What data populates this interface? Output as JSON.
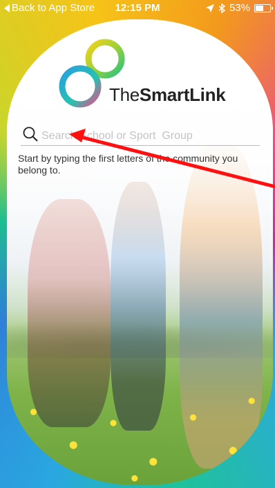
{
  "status_bar": {
    "back_label": "Back to App Store",
    "time": "12:15 PM",
    "battery": "53%"
  },
  "logo": {
    "prefix": "The",
    "bold": "SmartLink"
  },
  "search": {
    "placeholder": "Search School or Sport  Group",
    "value": ""
  },
  "hint": "Start by typing the first letters of the community you belong to.",
  "colors": {
    "annotation_red": "#ff1010",
    "logo_blue": "#2a9fe0",
    "logo_green": "#27c27f",
    "logo_yellow": "#f3d21a"
  }
}
